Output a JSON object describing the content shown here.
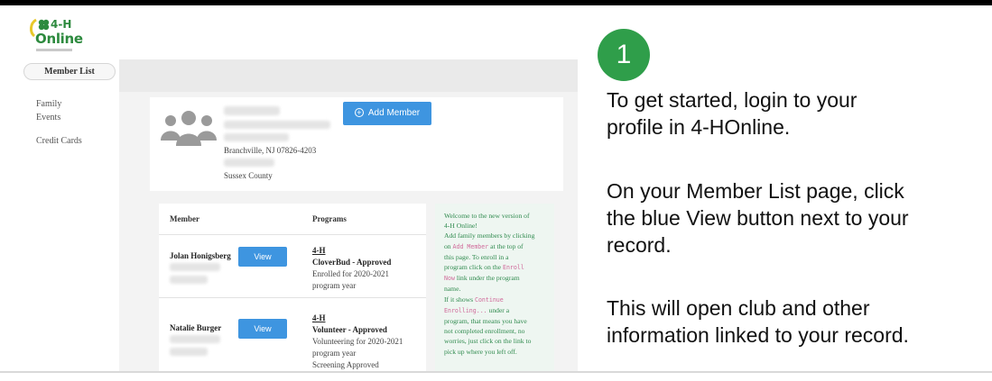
{
  "logo": {
    "line1": "4-H",
    "line2": "Online"
  },
  "sidebar": {
    "active": "Member List",
    "items": [
      "Family",
      "Events",
      "Credit Cards"
    ]
  },
  "profile": {
    "address": "Branchville, NJ 07826-4203",
    "county": "Sussex County",
    "add_member_label": "Add Member"
  },
  "table": {
    "col_member": "Member",
    "col_programs": "Programs",
    "rows": [
      {
        "name": "Jolan Honigsberg",
        "view_label": "View",
        "program": "4-H",
        "status": "CloverBud - Approved",
        "detail1": "Enrolled for 2020-2021",
        "detail2": "program year",
        "detail3": ""
      },
      {
        "name": "Natalie Burger",
        "view_label": "View",
        "program": "4-H",
        "status": "Volunteer - Approved",
        "detail1": "Volunteering for 2020-2021",
        "detail2": "program year",
        "detail3": "Screening Approved"
      }
    ]
  },
  "welcome": {
    "l1": "Welcome to the new version of",
    "l2": "4-H Online!",
    "l3": "Add family members by clicking",
    "l4a": "on",
    "l4code": "Add Member",
    "l4b": "at the top of",
    "l5": "this page. To enroll in a",
    "l6a": "program click on the",
    "l6code": "Enroll",
    "l7code": "Now",
    "l7b": "link under the program",
    "l8": "name.",
    "l9a": "If it shows",
    "l9code": "Continue",
    "l10code": "Enrolling...",
    "l10b": "under a",
    "l11": "program, that means you have",
    "l12": "not completed enrollment, no",
    "l13": "worries, just click on the link to",
    "l14": "pick up where you left off."
  },
  "step": {
    "number": "1",
    "para1_line1": "To get started, login to your",
    "para1_line2": "profile in 4-HOnline.",
    "para2_line1": "On your Member List page, click",
    "para2_line2": "the blue View button next to your",
    "para2_line3": "record.",
    "para3_line1": "This will open club and other",
    "para3_line2": "information linked to your record."
  },
  "colors": {
    "brand_green": "#2f9e4a",
    "button_blue": "#3e95e0",
    "welcome_text": "#2f8a4e"
  }
}
